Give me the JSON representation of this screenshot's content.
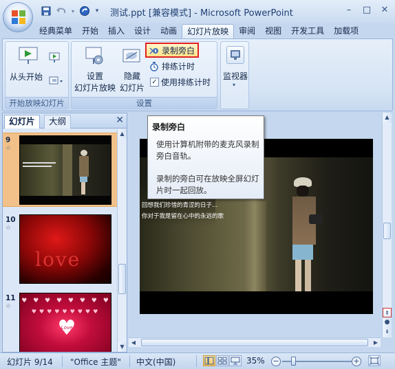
{
  "window": {
    "title": "测试.ppt [兼容模式] - Microsoft PowerPoint",
    "minimize": "–",
    "maximize": "□",
    "close": "✕"
  },
  "tabs": [
    "经典菜单",
    "开始",
    "插入",
    "设计",
    "动画",
    "幻灯片放映",
    "审阅",
    "视图",
    "开发工具",
    "加载项"
  ],
  "active_tab": "幻灯片放映",
  "ribbon": {
    "group_start": {
      "label": "开始放映幻灯片",
      "from_start": "从头开始"
    },
    "group_setup": {
      "label": "设置",
      "setup_show_line1": "设置",
      "setup_show_line2": "幻灯片放映",
      "hide_slide_line1": "隐藏",
      "hide_slide_line2": "幻灯片",
      "record_narration": "录制旁白",
      "rehearse_timings": "排练计时",
      "use_rehearsed_timings": "使用排练计时"
    },
    "group_monitors": {
      "label": "监视器"
    }
  },
  "left_panel": {
    "tab_slides": "幻灯片",
    "tab_outline": "大纲",
    "close": "✕",
    "thumbnails": [
      {
        "number": "9",
        "selected": true,
        "star": "☆"
      },
      {
        "number": "10",
        "selected": false,
        "star": "☆"
      },
      {
        "number": "11",
        "selected": false,
        "star": "☆"
      }
    ],
    "thumb10_text": "love",
    "thumb11_text": "Love"
  },
  "slide": {
    "line1": "回想我们珍惜的青涩的日子...",
    "line2": "你对于我是留在心中的永远的歌"
  },
  "tooltip": {
    "title": "录制旁白",
    "para1": "使用计算机附带的麦克风录制旁白音轨。",
    "para2": "录制的旁白可在放映全屏幻灯片时一起回放。"
  },
  "status": {
    "slide_counter": "幻灯片 9/14",
    "theme": "\"Office 主题\"",
    "language": "中文(中国)",
    "zoom": "35%"
  },
  "colors": {
    "ribbon_bg": "#d6e4f5",
    "highlight_border": "#e02020",
    "selected_thumb": "#f1c189",
    "window_bg": "#c4d7ee"
  }
}
